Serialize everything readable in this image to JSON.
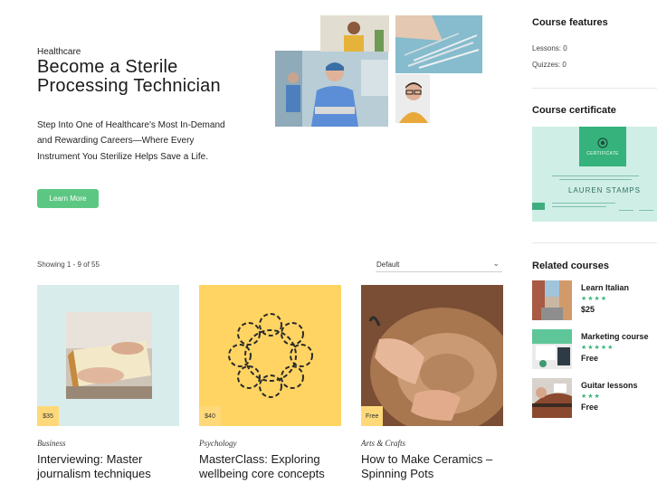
{
  "hero": {
    "eyebrow": "Healthcare",
    "title": "Become a Sterile Processing Technician",
    "description_lines": [
      "Step Into One of Healthcare's Most In-Demand",
      "and Rewarding Careers—Where Every",
      "Instrument You Sterilize Helps Save a Life."
    ],
    "cta_label": "Learn More",
    "cta_color": "#5cc782"
  },
  "listing": {
    "showing_text": "Showing 1 - 9 of 55",
    "sort_value": "Default"
  },
  "courses": [
    {
      "category": "Business",
      "title": "Interviewing: Master journalism techniques",
      "price": "$35",
      "thumb_bg": "#d8ecec"
    },
    {
      "category": "Psychology",
      "title": "MasterClass: Exploring wellbeing core concepts",
      "price": "$40",
      "thumb_bg": "#ffd462"
    },
    {
      "category": "Arts & Crafts",
      "title": "How to Make Ceramics – Spinning Pots",
      "price": "Free",
      "thumb_bg": "#b7835a"
    }
  ],
  "sidebar": {
    "features_heading": "Course features",
    "lessons": "Lessons: 0",
    "quizzes": "Quizzes: 0",
    "certificate_heading": "Course certificate",
    "certificate": {
      "badge_label": "CERTIFICATE",
      "recipient": "LAUREN STAMPS"
    },
    "related_heading": "Related courses",
    "related": [
      {
        "title": "Learn Italian",
        "rating": 4,
        "price": "$25"
      },
      {
        "title": "Marketing course",
        "rating": 5,
        "price": "Free"
      },
      {
        "title": "Guitar lessons",
        "rating": 3,
        "price": "Free"
      }
    ]
  },
  "colors": {
    "accent_green": "#5cc782",
    "price_badge": "#ffd979",
    "star": "#3ab47a"
  }
}
